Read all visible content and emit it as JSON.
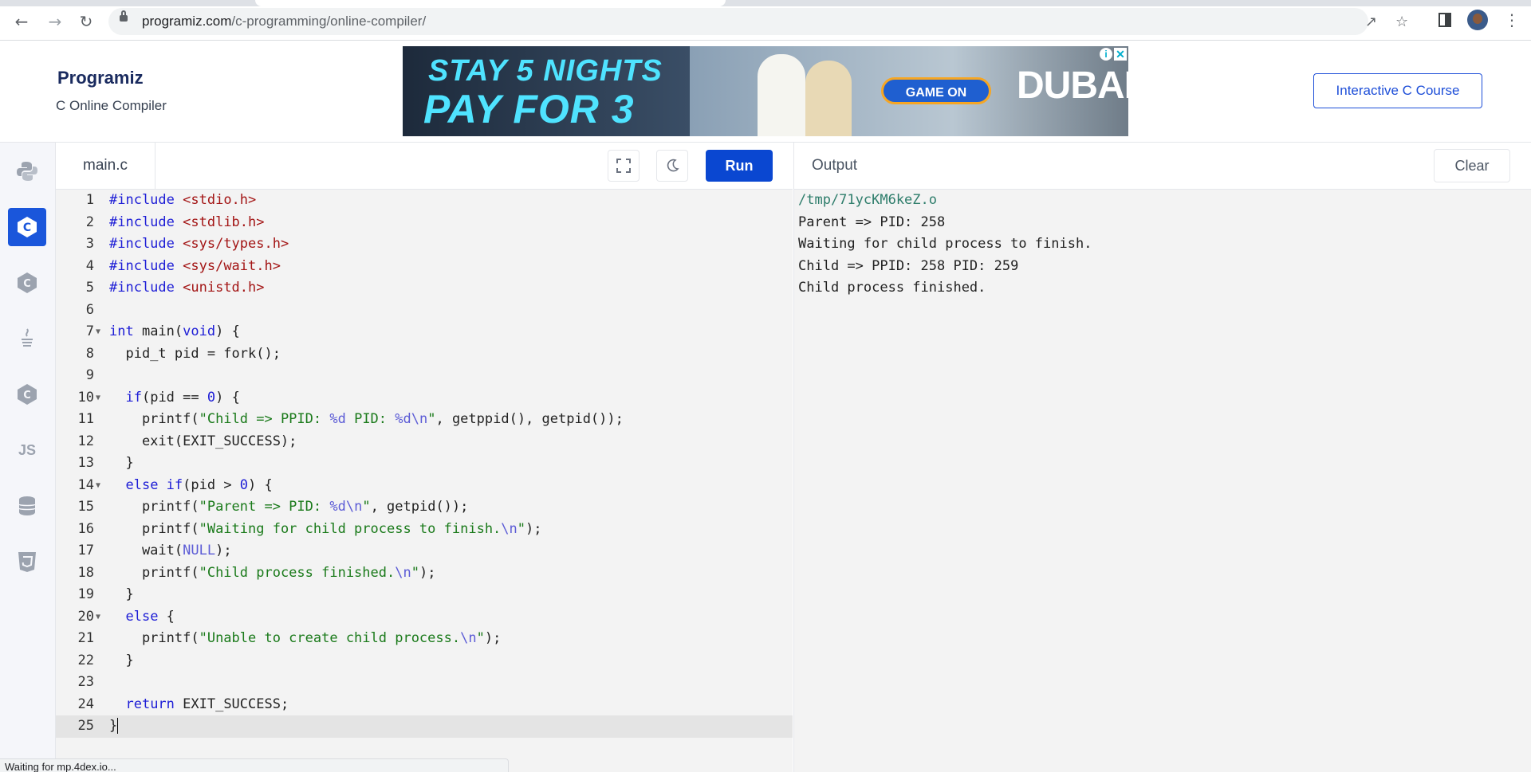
{
  "browser": {
    "url_host": "programiz.com",
    "url_path": "/c-programming/online-compiler/"
  },
  "header": {
    "logo_text": "Programiz",
    "subtitle": "C Online Compiler",
    "course_button": "Interactive C Course"
  },
  "ad": {
    "line1": "STAY 5 NIGHTS",
    "line2": "PAY FOR 3",
    "cta": "GAME ON",
    "brand": "DUBAI"
  },
  "sidebar": {
    "items": [
      {
        "name": "python",
        "icon": "python-icon"
      },
      {
        "name": "c",
        "icon": "c-icon",
        "active": true
      },
      {
        "name": "cpp",
        "icon": "cpp-icon"
      },
      {
        "name": "java",
        "icon": "java-icon"
      },
      {
        "name": "csharp",
        "icon": "csharp-icon"
      },
      {
        "name": "javascript",
        "icon": "js-icon",
        "label": "JS"
      },
      {
        "name": "sql",
        "icon": "database-icon"
      },
      {
        "name": "html",
        "icon": "html5-icon"
      }
    ]
  },
  "editor": {
    "filename": "main.c",
    "run_label": "Run",
    "lines": [
      "#include <stdio.h>",
      "#include <stdlib.h>",
      "#include <sys/types.h>",
      "#include <sys/wait.h>",
      "#include <unistd.h>",
      "",
      "int main(void) {",
      "  pid_t pid = fork();",
      "",
      "  if(pid == 0) {",
      "    printf(\"Child => PPID: %d PID: %d\\n\", getppid(), getpid());",
      "    exit(EXIT_SUCCESS);",
      "  }",
      "  else if(pid > 0) {",
      "    printf(\"Parent => PID: %d\\n\", getpid());",
      "    printf(\"Waiting for child process to finish.\\n\");",
      "    wait(NULL);",
      "    printf(\"Child process finished.\\n\");",
      "  }",
      "  else {",
      "    printf(\"Unable to create child process.\\n\");",
      "  }",
      "",
      "  return EXIT_SUCCESS;",
      "}"
    ]
  },
  "output": {
    "title": "Output",
    "clear_label": "Clear",
    "lines": [
      "/tmp/71ycKM6keZ.o",
      "Parent => PID: 258",
      "Waiting for child process to finish.",
      "Child => PPID: 258 PID: 259",
      "Child process finished."
    ]
  },
  "status_text": "Waiting for mp.4dex.io..."
}
